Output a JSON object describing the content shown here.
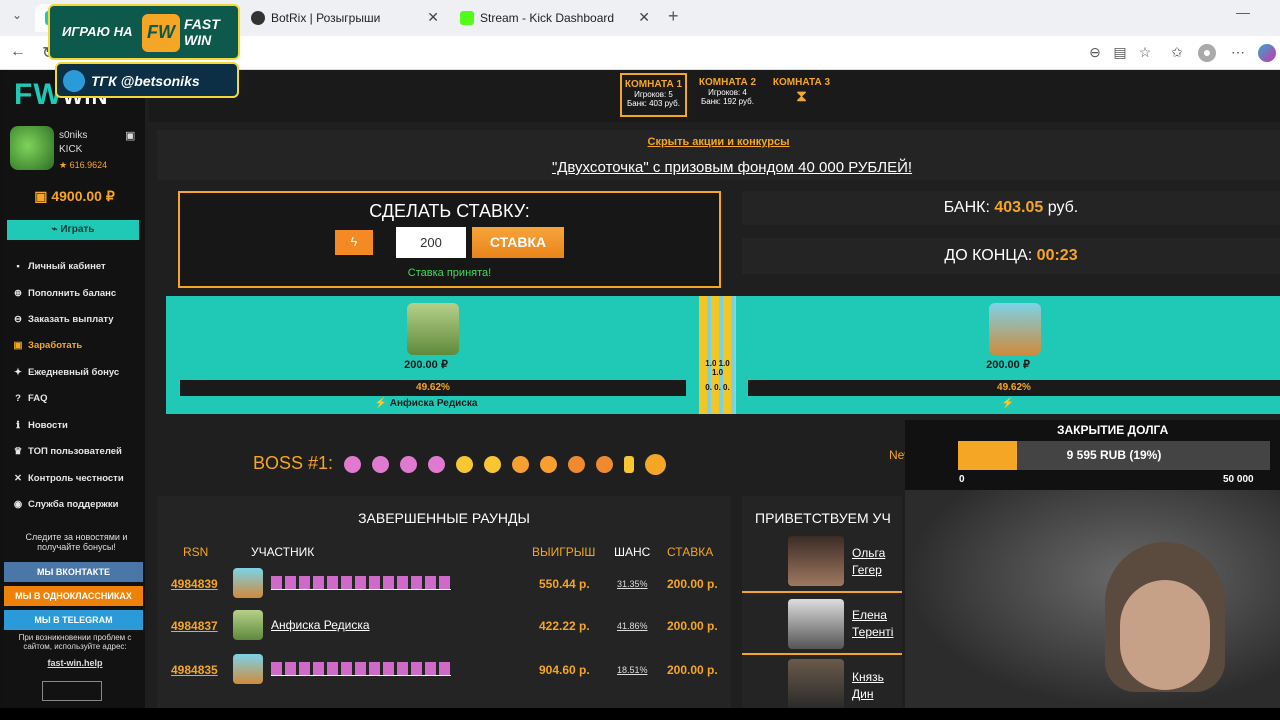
{
  "browser": {
    "tabs": [
      {
        "title": "",
        "active": true
      },
      {
        "title": "BotRix | Розыгрыши"
      },
      {
        "title": "Stream - Kick Dashboard"
      }
    ],
    "url": "fast-win.com/?room=1"
  },
  "overlay": {
    "play_on": "ИГРАЮ НА",
    "brand": "FAST WIN",
    "telegram": "ТГК @betsoniks"
  },
  "sidebar": {
    "logo_fw": "FW",
    "logo_win": "WIN",
    "username": "s0niks",
    "platform": "KICK",
    "rating": "★ 616.9624",
    "balance": "4900.00 ₽",
    "play_button": "Играть",
    "menu": [
      {
        "icon": "user-icon",
        "label": "Личный кабинет"
      },
      {
        "icon": "plus-icon",
        "label": "Пополнить баланс"
      },
      {
        "icon": "download-icon",
        "label": "Заказать выплату"
      },
      {
        "icon": "money-icon",
        "label": "Заработать",
        "highlight": true
      },
      {
        "icon": "gift-icon",
        "label": "Ежедневный бонус"
      },
      {
        "icon": "question-icon",
        "label": "FAQ"
      },
      {
        "icon": "news-icon",
        "label": "Новости"
      },
      {
        "icon": "trophy-icon",
        "label": "ТОП пользователей"
      },
      {
        "icon": "shuffle-icon",
        "label": "Контроль честности"
      },
      {
        "icon": "support-icon",
        "label": "Служба поддержки"
      }
    ],
    "social_promo": "Следите за новостями и получайте бонусы!",
    "social": [
      {
        "label": "МЫ ВКОНТАКТЕ",
        "color": "#4a76a8"
      },
      {
        "label": "МЫ В ОДНОКЛАССНИКАХ",
        "color": "#ee8208"
      },
      {
        "label": "МЫ В TELEGRAM",
        "color": "#2a9bd8"
      }
    ],
    "footer_note": "При возникновении проблем с сайтом, используйте адрес:",
    "footer_link": "fast-win.help"
  },
  "rooms": [
    {
      "title": "КОМНАТА 1",
      "players": "Игроков: 5",
      "bank": "Банк: 403 руб.",
      "active": true
    },
    {
      "title": "КОМНАТА 2",
      "players": "Игроков: 4",
      "bank": "Банк: 192 руб."
    },
    {
      "title": "КОМНАТА 3",
      "icon": "hourglass-icon"
    }
  ],
  "promo": {
    "hide_link": "Скрыть акции и конкурсы",
    "link": "\"Двухсоточка\" с призовым фондом 40 000 РУБЛЕЙ!"
  },
  "bet": {
    "title": "СДЕЛАТЬ СТАВКУ:",
    "value": "200",
    "button": "СТАВКА",
    "status": "Ставка принята!"
  },
  "bank": {
    "label": "БАНК:",
    "value": "403.05",
    "unit": "руб."
  },
  "timer": {
    "label": "ДО КОНЦА:",
    "value": "00:23"
  },
  "arena": {
    "left": {
      "amount": "200.00 ₽",
      "chance": "49.62%",
      "name": "⚡ Анфиска Редиска"
    },
    "right": {
      "amount": "200.00 ₽",
      "chance": "49.62%",
      "name": "⚡"
    },
    "mid_top": "1.0 1.0 1.0",
    "mid_bottom": "0. 0. 0."
  },
  "boss": {
    "label": "BOSS #1:",
    "new_label": "New Boss:"
  },
  "rounds": {
    "title": "ЗАВЕРШЕННЫЕ РАУНДЫ",
    "headers": {
      "rsn": "RSN",
      "participant": "УЧАСТНИК",
      "win": "ВЫИГРЫШ",
      "chance": "ШАНС",
      "bet": "СТАВКА"
    },
    "rows": [
      {
        "rsn": "4984839",
        "name": "",
        "win": "550.44 р.",
        "chance": "31.35%",
        "bet": "200.00 р."
      },
      {
        "rsn": "4984837",
        "name": "Анфиска Редиска",
        "win": "422.22 р.",
        "chance": "41.86%",
        "bet": "200.00 р."
      },
      {
        "rsn": "4984835",
        "name": "",
        "win": "904.60 р.",
        "chance": "18.51%",
        "bet": "200.00 р."
      }
    ]
  },
  "greet": {
    "title": "ПРИВЕТСТВУЕМ УЧ",
    "people": [
      {
        "name1": "Ольга",
        "name2": "Гегер"
      },
      {
        "name1": "Елена",
        "name2": "Терентi"
      },
      {
        "name1": "Князь",
        "name2": "Дин"
      }
    ]
  },
  "debt": {
    "title": "ЗАКРЫТИЕ ДОЛГА",
    "progress_label": "9 595 RUB (19%)",
    "progress_fraction": 0.19,
    "min": "0",
    "max": "50 000"
  }
}
